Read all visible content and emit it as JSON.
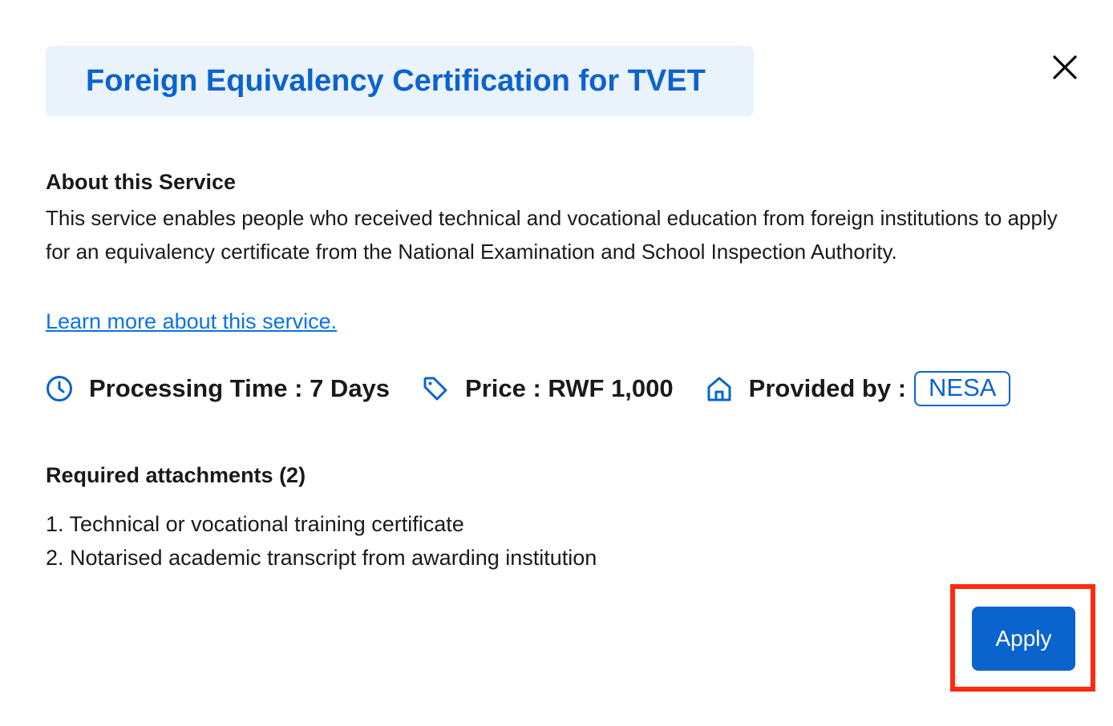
{
  "dialog": {
    "title": "Foreign Equivalency Certification for TVET",
    "close_icon": "close-icon"
  },
  "about": {
    "heading": "About this Service",
    "description": "This service enables people who received technical and vocational education from foreign institutions to apply for an equivalency certificate from the National Examination and School Inspection Authority.",
    "learn_more_link": "Learn more about this service."
  },
  "meta": {
    "processing_time": {
      "icon": "clock-icon",
      "label": "Processing Time : 7 Days"
    },
    "price": {
      "icon": "price-tag-icon",
      "label": "Price : RWF 1,000"
    },
    "provider": {
      "icon": "home-icon",
      "label": "Provided by :",
      "badge": "NESA"
    }
  },
  "attachments": {
    "heading": "Required attachments (2)",
    "items": [
      "1. Technical or vocational training certificate",
      "2. Notarised academic transcript from awarding institution"
    ]
  },
  "actions": {
    "apply_label": "Apply"
  },
  "colors": {
    "accent": "#0b63ce",
    "link": "#0b72e7",
    "title_bg": "#eaf2fc",
    "highlight": "#ff2a10"
  }
}
